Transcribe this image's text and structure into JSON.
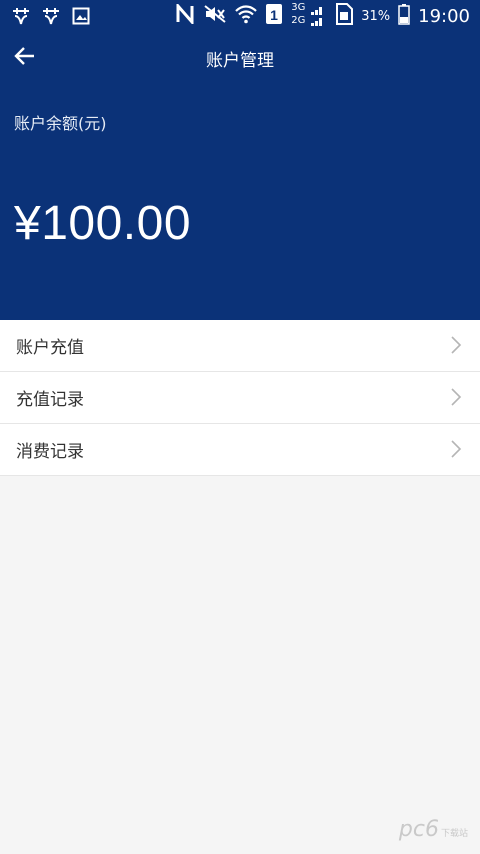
{
  "status_bar": {
    "battery_percent": "31%",
    "time": "19:00",
    "network_top": "3G",
    "network_bottom": "2G",
    "icons": [
      "chat-icon",
      "chat-icon",
      "image-icon",
      "nfc-icon",
      "mute-icon",
      "wifi-icon",
      "sim-1-icon",
      "signal-icon",
      "sim-card-icon",
      "battery-icon"
    ]
  },
  "navbar": {
    "title": "账户管理",
    "back_icon": "arrow-left-icon"
  },
  "balance": {
    "label": "账户余额(元)",
    "amount": "¥100.00"
  },
  "menu": {
    "items": [
      {
        "label": "账户充值",
        "icon": "chevron-right-icon"
      },
      {
        "label": "充值记录",
        "icon": "chevron-right-icon"
      },
      {
        "label": "消费记录",
        "icon": "chevron-right-icon"
      }
    ]
  },
  "watermark": {
    "text": "pc6",
    "subtext": "下载站"
  },
  "colors": {
    "header_bg": "#0b3278",
    "page_bg": "#f5f5f5",
    "menu_bg": "#ffffff",
    "text_primary": "#333333"
  }
}
